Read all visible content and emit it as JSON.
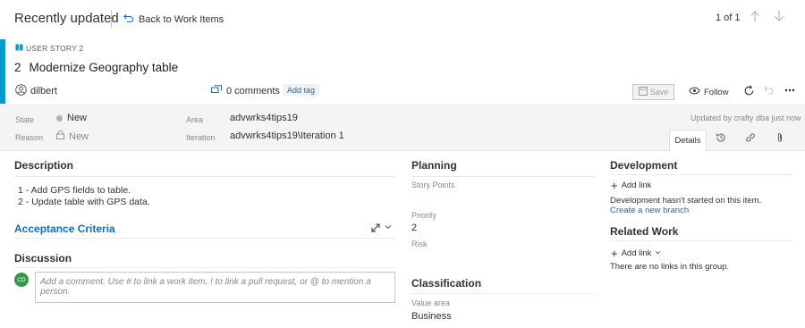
{
  "topbar": {
    "title": "Recently updated",
    "back_label": "Back to Work Items",
    "pager": "1 of 1"
  },
  "work_item": {
    "type": "USER STORY 2",
    "id": "2",
    "title": "Modernize Geography table",
    "assignee": "dilbert",
    "comments": "0 comments",
    "add_tag": "Add tag",
    "save_label": "Save",
    "follow_label": "Follow",
    "accent_color": "#009ccc"
  },
  "fields": {
    "state_label": "State",
    "state_value": "New",
    "reason_label": "Reason",
    "reason_value": "New",
    "area_label": "Area",
    "area_value": "advwrks4tips19",
    "iteration_label": "Iteration",
    "iteration_value": "advwrks4tips19\\Iteration 1",
    "updated_text": "Updated by crafty dba just now"
  },
  "tabs": {
    "details": "Details"
  },
  "description": {
    "title": "Description",
    "line1": "1 - Add GPS fields to table.",
    "line2": "2 - Update table with GPS data."
  },
  "acceptance": {
    "title": "Acceptance Criteria"
  },
  "discussion": {
    "title": "Discussion",
    "avatar_initials": "CD",
    "placeholder": "Add a comment. Use # to link a work item, ! to link a pull request, or @ to mention a person."
  },
  "planning": {
    "title": "Planning",
    "story_points_label": "Story Points",
    "priority_label": "Priority",
    "priority_value": "2",
    "risk_label": "Risk"
  },
  "classification": {
    "title": "Classification",
    "value_area_label": "Value area",
    "value_area_value": "Business"
  },
  "development": {
    "title": "Development",
    "add_link": "Add link",
    "status": "Development hasn't started on this item.",
    "create_branch": "Create a new branch"
  },
  "related": {
    "title": "Related Work",
    "add_link": "Add link",
    "status": "There are no links in this group."
  }
}
